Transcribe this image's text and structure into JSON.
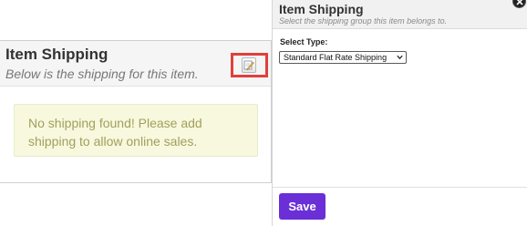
{
  "item_shipping_panel": {
    "title": "Item Shipping",
    "subtitle": "Below is the shipping for this item.",
    "empty_message": "No shipping found! Please add shipping to allow online sales."
  },
  "shipping_modal": {
    "title": "Item Shipping",
    "subtitle": "Select the shipping group this item belongs to.",
    "select_type_label": "Select Type:",
    "select_type_value": "Standard Flat Rate Shipping",
    "save_label": "Save"
  },
  "icons": {
    "edit": "edit-pencil-icon",
    "close": "close-icon",
    "dropdown": "chevron-down-icon"
  },
  "colors": {
    "save_button": "#6a2fd6",
    "highlight_border": "#e0403c",
    "alert_background": "#f8f8df",
    "alert_text": "#a1a05b"
  }
}
